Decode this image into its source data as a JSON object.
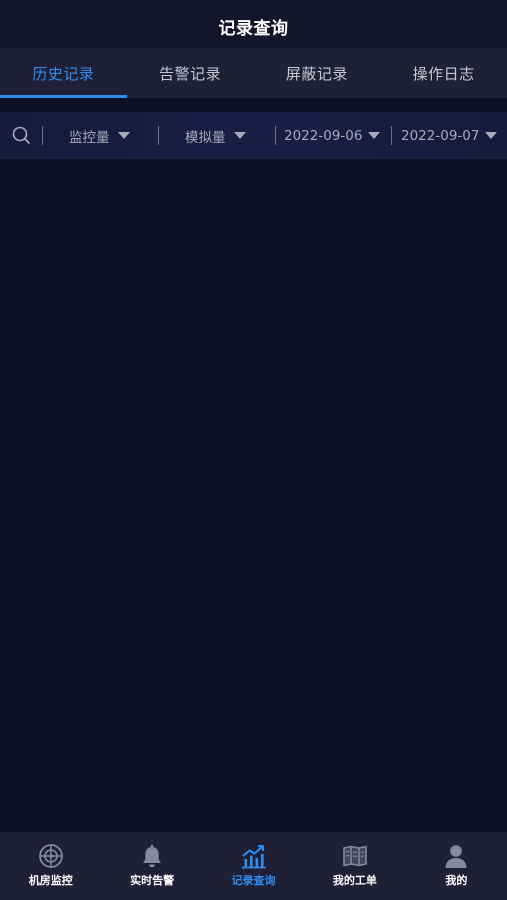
{
  "header": {
    "title": "记录查询"
  },
  "tabs": [
    {
      "label": "历史记录",
      "active": true
    },
    {
      "label": "告警记录",
      "active": false
    },
    {
      "label": "屏蔽记录",
      "active": false
    },
    {
      "label": "操作日志",
      "active": false
    }
  ],
  "filters": {
    "search": {
      "icon": "search-icon"
    },
    "monitor_point": {
      "value": "监控量",
      "icon": "caret-down-icon"
    },
    "quantity_type": {
      "value": "模拟量",
      "icon": "caret-down-icon"
    },
    "start_date": {
      "value": "2022-09-06",
      "icon": "caret-down-icon"
    },
    "end_date": {
      "value": "2022-09-07",
      "icon": "caret-down-icon"
    }
  },
  "bottom_nav": {
    "items": [
      {
        "label": "机房监控",
        "icon": "radar-icon",
        "active": false
      },
      {
        "label": "实时告警",
        "icon": "bell-icon",
        "active": false
      },
      {
        "label": "记录查询",
        "icon": "chart-icon",
        "active": true
      },
      {
        "label": "我的工单",
        "icon": "work-order-icon",
        "active": false
      },
      {
        "label": "我的",
        "icon": "user-icon",
        "active": false
      }
    ]
  },
  "colors": {
    "accent": "#2e8ef0",
    "page_bg": "#0f0f24",
    "header_bg": "#14142b",
    "tab_bg": "#1f1f36",
    "filter_bg": "#161b3d",
    "nav_bg": "#1f1f35",
    "muted": "#a8abba",
    "icon": "#878a9b"
  }
}
